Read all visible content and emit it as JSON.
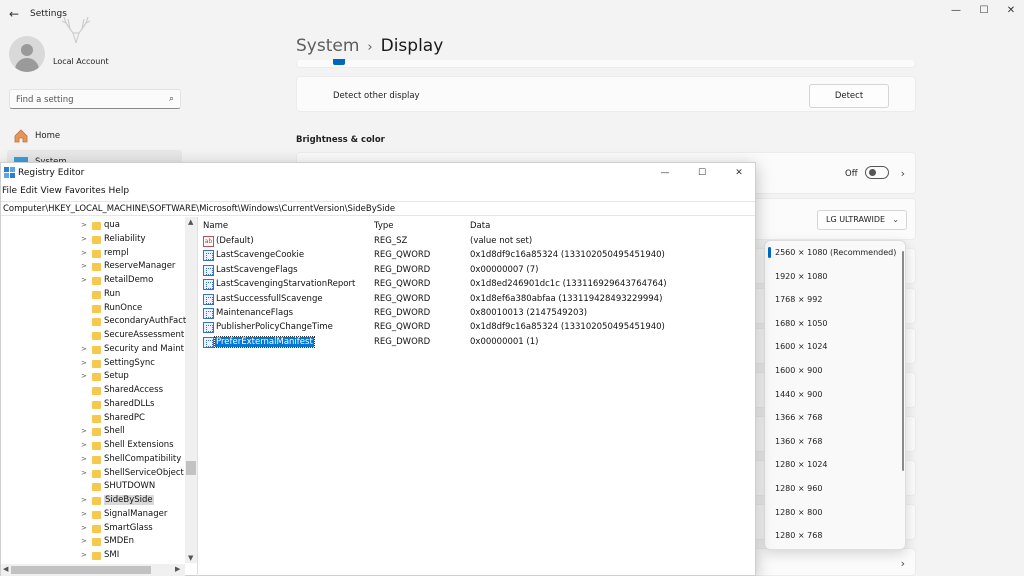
{
  "settings": {
    "window_title": "Settings",
    "account_name": "Local Account",
    "search_placeholder": "Find a setting",
    "nav": [
      {
        "label": "Home"
      },
      {
        "label": "System"
      }
    ],
    "breadcrumb_parent": "System",
    "breadcrumb_current": "Display",
    "detect_label": "Detect other display",
    "detect_button": "Detect",
    "section_brightness": "Brightness & color",
    "toggle_state": "Off",
    "monitor_selected": "LG ULTRAWIDE",
    "resolution_options": [
      "2560 × 1080 (Recommended)",
      "1920 × 1080",
      "1768 × 992",
      "1680 × 1050",
      "1600 × 1024",
      "1600 × 900",
      "1440 × 900",
      "1366 × 768",
      "1360 × 768",
      "1280 × 1024",
      "1280 × 960",
      "1280 × 800",
      "1280 × 768"
    ],
    "accent_color": "#0067c0"
  },
  "regedit": {
    "window_title": "Registry Editor",
    "menu": [
      "File",
      "Edit",
      "View",
      "Favorites",
      "Help"
    ],
    "address": "Computer\\HKEY_LOCAL_MACHINE\\SOFTWARE\\Microsoft\\Windows\\CurrentVersion\\SideBySide",
    "tree": [
      {
        "label": "qua",
        "expandable": true
      },
      {
        "label": "Reliability",
        "expandable": true
      },
      {
        "label": "rempl",
        "expandable": true
      },
      {
        "label": "ReserveManager",
        "expandable": true
      },
      {
        "label": "RetailDemo",
        "expandable": true
      },
      {
        "label": "Run",
        "expandable": false
      },
      {
        "label": "RunOnce",
        "expandable": false
      },
      {
        "label": "SecondaryAuthFact",
        "expandable": false
      },
      {
        "label": "SecureAssessment",
        "expandable": false
      },
      {
        "label": "Security and Maint",
        "expandable": true
      },
      {
        "label": "SettingSync",
        "expandable": true
      },
      {
        "label": "Setup",
        "expandable": true
      },
      {
        "label": "SharedAccess",
        "expandable": false
      },
      {
        "label": "SharedDLLs",
        "expandable": false
      },
      {
        "label": "SharedPC",
        "expandable": false
      },
      {
        "label": "Shell",
        "expandable": true
      },
      {
        "label": "Shell Extensions",
        "expandable": true
      },
      {
        "label": "ShellCompatibility",
        "expandable": true
      },
      {
        "label": "ShellServiceObject",
        "expandable": true
      },
      {
        "label": "SHUTDOWN",
        "expandable": false
      },
      {
        "label": "SideBySide",
        "expandable": true,
        "selected": true
      },
      {
        "label": "SignalManager",
        "expandable": true
      },
      {
        "label": "SmartGlass",
        "expandable": true
      },
      {
        "label": "SMDEn",
        "expandable": true
      },
      {
        "label": "SMI",
        "expandable": true
      }
    ],
    "columns": {
      "name": "Name",
      "type": "Type",
      "data": "Data"
    },
    "values": [
      {
        "name": "(Default)",
        "type": "REG_SZ",
        "data": "(value not set)",
        "icon": "string-value-icon"
      },
      {
        "name": "LastScavengeCookie",
        "type": "REG_QWORD",
        "data": "0x1d8df9c16a85324 (133102050495451940)",
        "icon": "binary-value-icon"
      },
      {
        "name": "LastScavengeFlags",
        "type": "REG_DWORD",
        "data": "0x00000007 (7)",
        "icon": "binary-value-icon"
      },
      {
        "name": "LastScavengingStarvationReport",
        "type": "REG_QWORD",
        "data": "0x1d8ed246901dc1c (133116929643764764)",
        "icon": "binary-value-icon"
      },
      {
        "name": "LastSuccessfullScavenge",
        "type": "REG_QWORD",
        "data": "0x1d8ef6a380abfaa (133119428493229994)",
        "icon": "binary-value-icon"
      },
      {
        "name": "MaintenanceFlags",
        "type": "REG_DWORD",
        "data": "0x80010013 (2147549203)",
        "icon": "binary-value-icon"
      },
      {
        "name": "PublisherPolicyChangeTime",
        "type": "REG_QWORD",
        "data": "0x1d8df9c16a85324 (133102050495451940)",
        "icon": "binary-value-icon"
      },
      {
        "name": "PreferExternalManifest",
        "type": "REG_DWORD",
        "data": "0x00000001 (1)",
        "icon": "binary-value-icon",
        "selected": true
      }
    ],
    "selection_color": "#0078d7"
  }
}
